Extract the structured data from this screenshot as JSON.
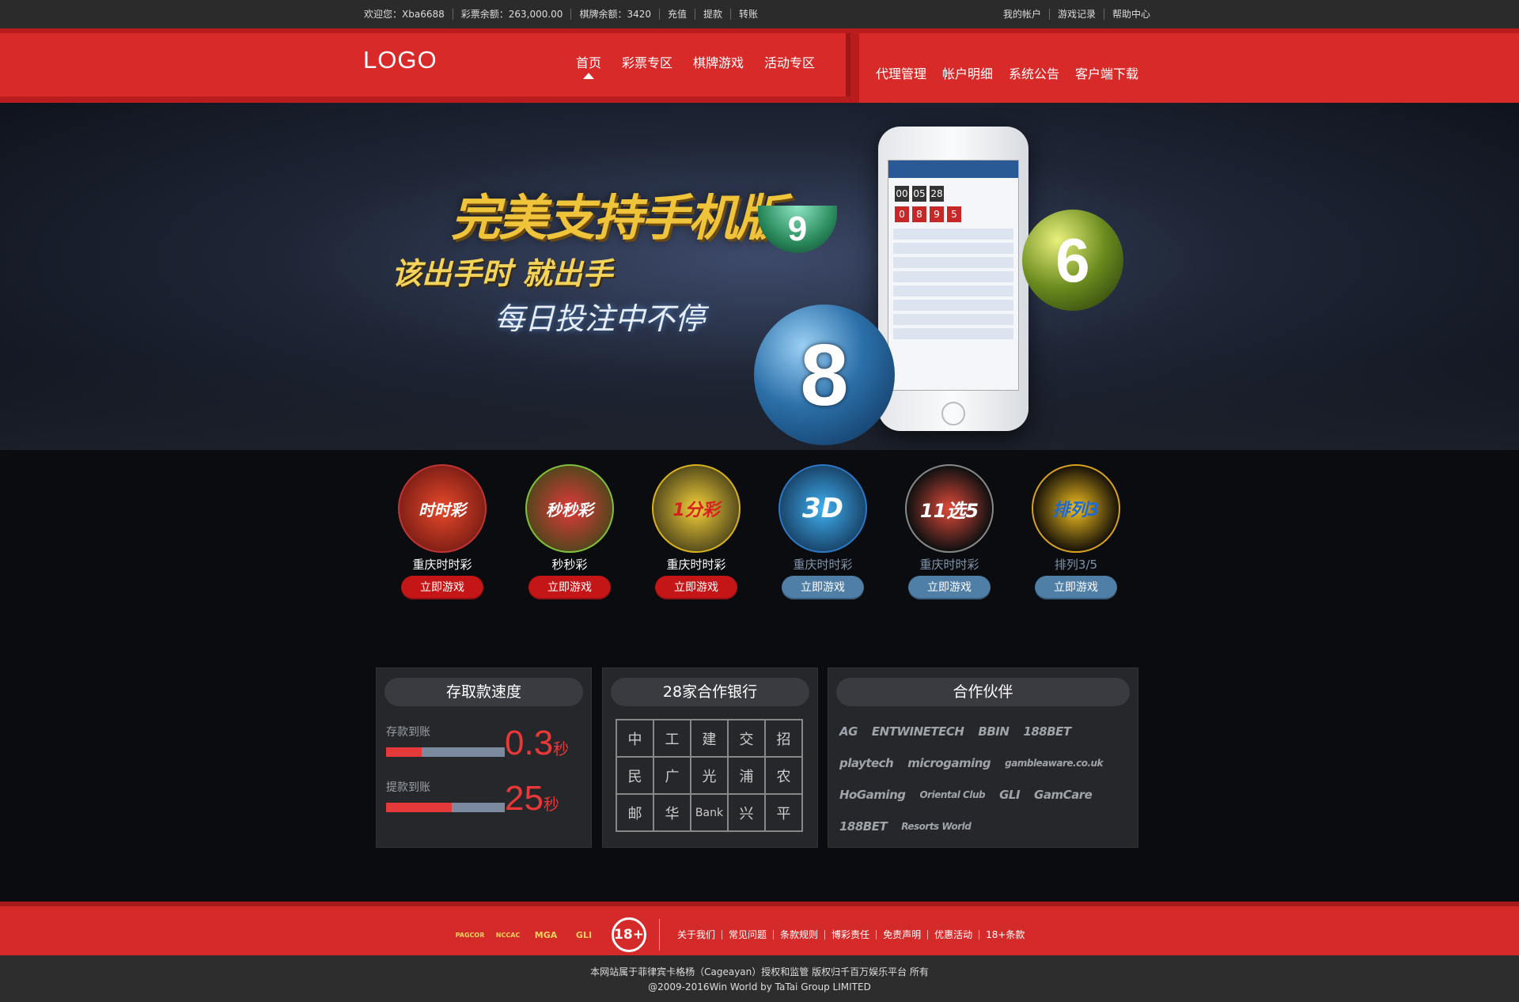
{
  "topbar": {
    "left": [
      "欢迎您：Xba6688",
      "彩票余额：263,000.00",
      "棋牌余额：3420",
      "充值",
      "提款",
      "转账"
    ],
    "right": [
      "我的帐户",
      "游戏记录",
      "帮助中心"
    ]
  },
  "logo": "LOGO",
  "nav": {
    "main": [
      "首页",
      "彩票专区",
      "棋牌游戏",
      "活动专区"
    ],
    "sub": [
      "代理管理",
      "帐户明细",
      "系统公告",
      "客户端下载"
    ]
  },
  "banner": {
    "headline": "完美支持手机版",
    "line1": "该出手时 就出手",
    "line2": "每日投注中不停",
    "ball_8": "8",
    "ball_6": "6",
    "ball_9": "9",
    "phone_digits": [
      "0",
      "8",
      "9",
      "5"
    ],
    "phone_timer": [
      "00",
      "05",
      "28"
    ]
  },
  "games": [
    {
      "name": "重庆时时彩",
      "button": "立即游戏",
      "style": "red",
      "icon": "时时彩",
      "ring": "#c23434"
    },
    {
      "name": "秒秒彩",
      "button": "立即游戏",
      "style": "red",
      "icon": "秒秒彩",
      "ring": "#7fc13a"
    },
    {
      "name": "重庆时时彩",
      "button": "立即游戏",
      "style": "red",
      "icon": "1分彩",
      "ring": "#d9b21e"
    },
    {
      "name": "重庆时时彩",
      "button": "立即游戏",
      "style": "blue",
      "icon": "3D",
      "ring": "#2c78c4"
    },
    {
      "name": "重庆时时彩",
      "button": "立即游戏",
      "style": "blue",
      "icon": "11选5",
      "ring": "#888888"
    },
    {
      "name": "排列3/5",
      "button": "立即游戏",
      "style": "blue",
      "icon": "排列3",
      "ring": "#d9a21e"
    }
  ],
  "speed": {
    "title": "存取款速度",
    "deposit_label": "存款到账",
    "deposit_value": "0.3",
    "deposit_unit": "秒",
    "deposit_fill": 0.3,
    "withdraw_label": "提款到账",
    "withdraw_value": "25",
    "withdraw_unit": "秒",
    "withdraw_fill": 0.55
  },
  "banks": {
    "title": "28家合作银行",
    "cells": [
      "中",
      "工",
      "建",
      "交",
      "招",
      "民",
      "广",
      "光",
      "浦",
      "农",
      "邮",
      "华",
      "Bank",
      "兴",
      "平"
    ]
  },
  "partners": {
    "title": "合作伙伴",
    "items": [
      "AG",
      "ENTWINETECH",
      "BBIN",
      "188BET",
      "playtech",
      "microgaming",
      "gambleaware.co.uk",
      "HoGaming",
      "Oriental Club",
      "GLI",
      "GamCare",
      "188BET",
      "Resorts World"
    ]
  },
  "footer": {
    "badges": [
      "PAGCOR",
      "NCCAC",
      "MGA",
      "GLI"
    ],
    "age_badge": "18+",
    "links": [
      "关于我们",
      "常见问题",
      "条款规则",
      "博彩责任",
      "免责声明",
      "优惠活动",
      "18+条款"
    ],
    "line1": "本网站属于菲律宾卡格杨（Cageayan）授权和监管 版权归千百万娱乐平台 所有",
    "line2": "@2009-2016Win World by TaTai Group LIMITED"
  },
  "colors": {
    "brand_red": "#d92a2a",
    "dark": "#2b2b2b",
    "accent_blue": "#4f7ea6"
  }
}
